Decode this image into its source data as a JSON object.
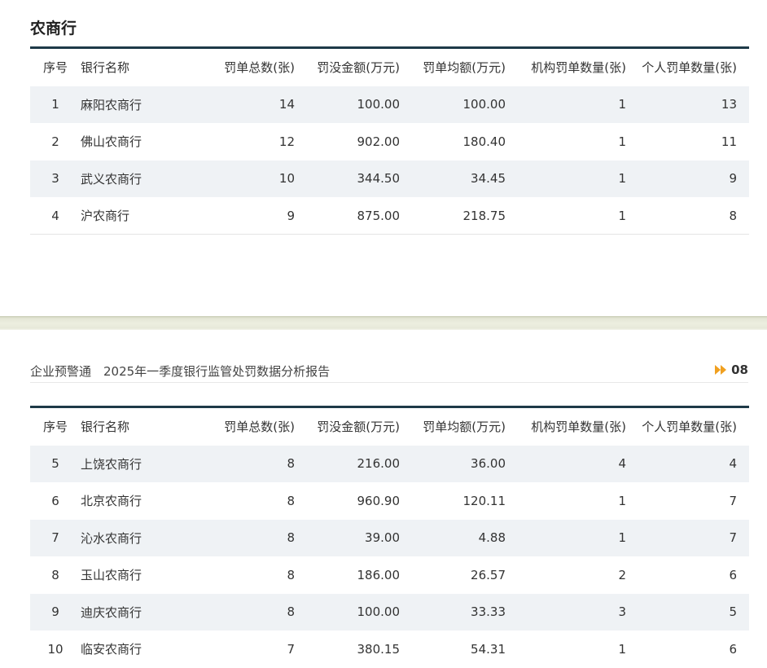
{
  "top": {
    "section_title": "农商行",
    "columns": [
      "序号",
      "银行名称",
      "罚单总数(张)",
      "罚没金额(万元)",
      "罚单均额(万元)",
      "机构罚单数量(张)",
      "个人罚单数量(张)"
    ],
    "rows": [
      [
        "1",
        "麻阳农商行",
        "14",
        "100.00",
        "100.00",
        "1",
        "13"
      ],
      [
        "2",
        "佛山农商行",
        "12",
        "902.00",
        "180.40",
        "1",
        "11"
      ],
      [
        "3",
        "武义农商行",
        "10",
        "344.50",
        "34.45",
        "1",
        "9"
      ],
      [
        "4",
        "沪农商行",
        "9",
        "875.00",
        "218.75",
        "1",
        "8"
      ]
    ]
  },
  "bottom": {
    "header_title": "企业预警通　2025年一季度银行监管处罚数据分析报告",
    "page_number": "08",
    "columns": [
      "序号",
      "银行名称",
      "罚单总数(张)",
      "罚没金额(万元)",
      "罚单均额(万元)",
      "机构罚单数量(张)",
      "个人罚单数量(张)"
    ],
    "rows": [
      [
        "5",
        "上饶农商行",
        "8",
        "216.00",
        "36.00",
        "4",
        "4"
      ],
      [
        "6",
        "北京农商行",
        "8",
        "960.90",
        "120.11",
        "1",
        "7"
      ],
      [
        "7",
        "沁水农商行",
        "8",
        "39.00",
        "4.88",
        "1",
        "7"
      ],
      [
        "8",
        "玉山农商行",
        "8",
        "186.00",
        "26.57",
        "2",
        "6"
      ],
      [
        "9",
        "迪庆农商行",
        "8",
        "100.00",
        "33.33",
        "3",
        "5"
      ],
      [
        "10",
        "临安农商行",
        "7",
        "380.15",
        "54.31",
        "1",
        "6"
      ]
    ]
  },
  "colors": {
    "header_rule": "#1e3a48",
    "row_stripe": "#eff2f5",
    "arrow": "#f0a020"
  },
  "icons": {
    "page_arrow": "double-chevron-right-icon"
  }
}
